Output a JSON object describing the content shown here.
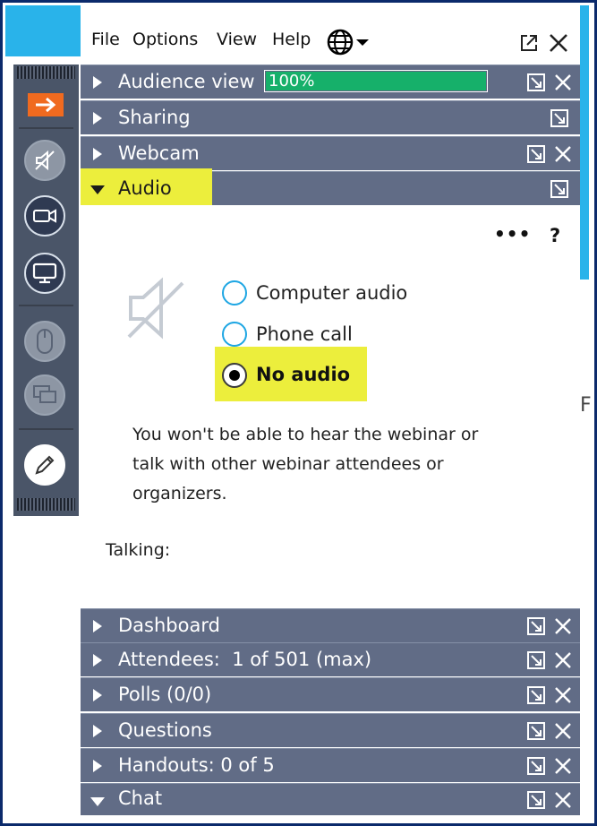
{
  "menubar": {
    "items": [
      "File",
      "Options",
      "View",
      "Help"
    ],
    "globe_icon": "globe-icon",
    "popout_icon": "popout-icon",
    "close_icon": "close-icon"
  },
  "sections": {
    "audience_view": {
      "label": "Audience view",
      "progress_text": "100%",
      "progress": 1.0
    },
    "sharing": {
      "label": "Sharing"
    },
    "webcam": {
      "label": "Webcam"
    },
    "audio": {
      "label": "Audio"
    },
    "dashboard": {
      "label": "Dashboard"
    },
    "attendees": {
      "label": "Attendees:  1 of 501 (max)"
    },
    "polls": {
      "label": "Polls (0/0)"
    },
    "questions": {
      "label": "Questions"
    },
    "handouts": {
      "label": "Handouts: 0 of 5"
    },
    "chat": {
      "label": "Chat"
    }
  },
  "audio": {
    "more_label": "•••",
    "help_label": "?",
    "options": [
      {
        "label": "Computer audio",
        "selected": false
      },
      {
        "label": "Phone call",
        "selected": false
      },
      {
        "label": "No audio",
        "selected": true
      }
    ],
    "message_lines": [
      "You won't be able to hear the webinar or",
      "talk with other webinar attendees or",
      "organizers."
    ],
    "talking_label": "Talking:"
  },
  "stray_text": "F",
  "colors": {
    "header_bg": "#616c86",
    "progress_fill": "#16b06a",
    "highlight": "#ecee3c",
    "accent_orange": "#f06a1f",
    "radio_ring": "#1ea6e3",
    "frame_border": "#0b2a6b"
  }
}
